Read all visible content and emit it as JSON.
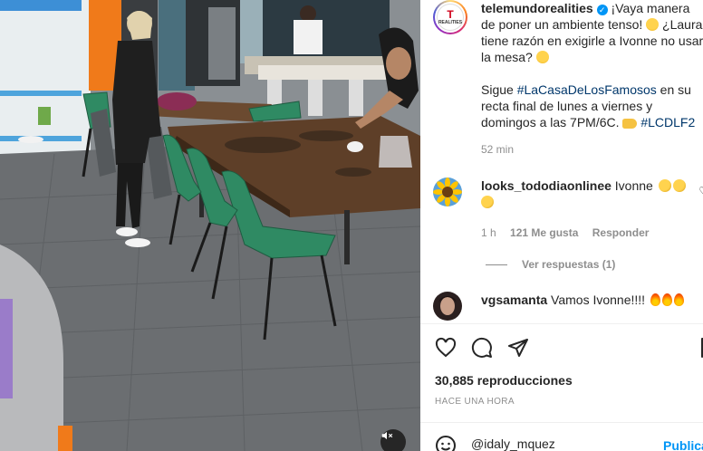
{
  "post": {
    "username": "telemundorealities",
    "logo_text": "REALITIES",
    "caption_line1": "¡Vaya manera de poner un ambiente tenso!",
    "caption_line2": "¿Laura tiene razón en exigirle a Ivonne no usar la mesa?",
    "caption_line3_pre": "Sigue ",
    "hashtag1": "#LaCasaDeLosFamosos",
    "caption_line3_post": " en su recta final de lunes a viernes y domingos a las 7PM/6C.",
    "hashtag2": "#LCDLF2",
    "time_ago": "52 min"
  },
  "comments": [
    {
      "username": "looks_tododiaonlinee",
      "text": "Ivonne",
      "time": "1 h",
      "likes": "121 Me gusta",
      "reply_label": "Responder",
      "view_replies": "Ver respuestas (1)"
    },
    {
      "username": "vgsamanta",
      "text": "Vamos Ivonne!!!!"
    }
  ],
  "footer": {
    "views": "30,885 reproducciones",
    "posted": "HACE UNA HORA",
    "comment_value": "@idaly_mquez",
    "publish_label": "Publicar"
  },
  "icons": {
    "like": "heart-icon",
    "comment": "comment-icon",
    "share": "paper-plane-icon",
    "save": "bookmark-icon",
    "emoji": "smiley-icon",
    "mute": "speaker-muted-icon"
  },
  "colors": {
    "link": "#00376b",
    "accent": "#0095f6",
    "meta": "#8e8e8e"
  }
}
